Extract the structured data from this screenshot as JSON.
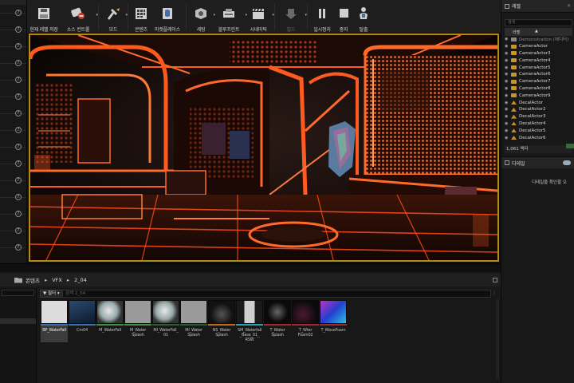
{
  "toolbar": {
    "buttons": [
      {
        "id": "save",
        "label": "현재 레벨 저장",
        "icon": "save-disk-icon"
      },
      {
        "id": "source",
        "label": "소스 컨트롤",
        "icon": "source-control-icon"
      },
      {
        "id": "modes",
        "label": "모드",
        "icon": "modes-tools-icon"
      },
      {
        "id": "content",
        "label": "콘텐츠",
        "icon": "content-grid-icon"
      },
      {
        "id": "market",
        "label": "마켓플레이스",
        "icon": "marketplace-icon"
      },
      {
        "id": "settings",
        "label": "세팅",
        "icon": "settings-icon"
      },
      {
        "id": "blueprint",
        "label": "블루프린트",
        "icon": "blueprint-icon"
      },
      {
        "id": "cinematic",
        "label": "시네마틱",
        "icon": "clapper-icon"
      },
      {
        "id": "build",
        "label": "빌드",
        "icon": "build-icon"
      },
      {
        "id": "pause",
        "label": "일시정지",
        "icon": "pause-icon"
      },
      {
        "id": "stop",
        "label": "중지",
        "icon": "stop-icon"
      },
      {
        "id": "eject",
        "label": "탈출",
        "icon": "eject-icon"
      }
    ]
  },
  "outliner": {
    "tab_label": "레벨",
    "search_placeholder": "검색",
    "header_label": "라벨",
    "root_item": "Demonstration (에디터)",
    "items": [
      {
        "label": "CameraActor",
        "type": "camera"
      },
      {
        "label": "CameraActor3",
        "type": "camera"
      },
      {
        "label": "CameraActor4",
        "type": "camera"
      },
      {
        "label": "CameraActor5",
        "type": "camera"
      },
      {
        "label": "CameraActor6",
        "type": "camera"
      },
      {
        "label": "CameraActor7",
        "type": "camera"
      },
      {
        "label": "CameraActor8",
        "type": "camera"
      },
      {
        "label": "CameraActor9",
        "type": "camera"
      },
      {
        "label": "DecalActor",
        "type": "decal"
      },
      {
        "label": "DecalActor2",
        "type": "decal"
      },
      {
        "label": "DecalActor3",
        "type": "decal"
      },
      {
        "label": "DecalActor4",
        "type": "decal"
      },
      {
        "label": "DecalActor5",
        "type": "decal"
      },
      {
        "label": "DecalActor6",
        "type": "decal"
      }
    ],
    "count_label": "1,061 액터"
  },
  "details": {
    "tab_label": "디테일",
    "empty_message": "디테일을 확인할 오"
  },
  "content_browser": {
    "path": [
      "콘텐츠",
      "VFX",
      "2_04"
    ],
    "filter_label": "필터",
    "search_placeholder": "검색 2_04",
    "assets": [
      {
        "name": "BP_WaterFall",
        "thumb": "bp",
        "bar": "#3a6fb0",
        "selected": true
      },
      {
        "name": "Cm04",
        "thumb": "blue-dark",
        "bar": "#3a6fb0",
        "selected": false
      },
      {
        "name": "M_WaterFall",
        "thumb": "sphere",
        "bar": "#3f8f3f",
        "selected": false
      },
      {
        "name": "M_Water\nSplash",
        "thumb": "gray",
        "bar": "#3f8f3f",
        "selected": false
      },
      {
        "name": "MI_WaterFall_\n01",
        "thumb": "sphere",
        "bar": "#2a5f2a",
        "selected": false
      },
      {
        "name": "MI_Water\nSplash",
        "thumb": "gray",
        "bar": "#2a5f2a",
        "selected": false
      },
      {
        "name": "NS_Water\nSplash",
        "thumb": "dark-noise",
        "bar": "#c06a20",
        "selected": false
      },
      {
        "name": "SM_Waterfall\n_Base_01_\nRSW",
        "thumb": "mesh",
        "bar": "#2aa0b0",
        "selected": false
      },
      {
        "name": "T_Water\nSplash",
        "thumb": "splash",
        "bar": "#a02a2a",
        "selected": false
      },
      {
        "name": "T_Wter\nFoam02",
        "thumb": "foam-dark",
        "bar": "#a02a2a",
        "selected": false
      },
      {
        "name": "T_WaveFoam",
        "thumb": "wave",
        "bar": "#a02a2a",
        "selected": false
      }
    ]
  }
}
